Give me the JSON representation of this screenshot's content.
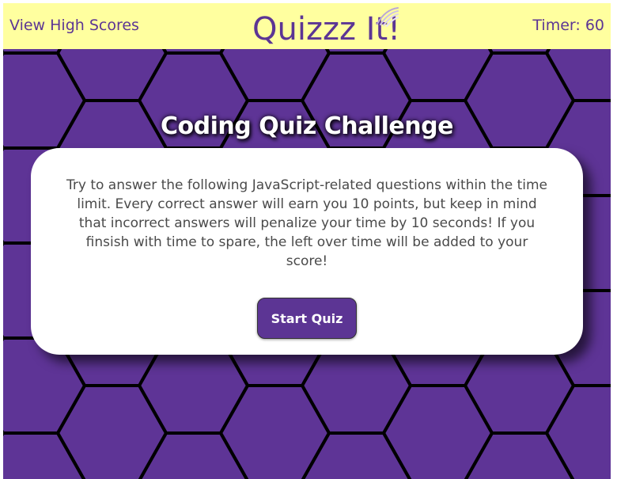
{
  "header": {
    "high_scores_link": "View High Scores",
    "logo_text": "Quizzz It!",
    "timer_label": "Timer: 60"
  },
  "main": {
    "title": "Coding Quiz Challenge",
    "intro_text": "Try to answer the following JavaScript-related questions within the time limit. Every correct answer will earn you 10 points, but keep in mind that incorrect answers will penalize your time by 10 seconds! If you finsish with time to spare, the left over time will be added to your score!",
    "start_button": "Start Quiz"
  },
  "icons": {
    "logo_swirl": "logo-swirl-icon"
  },
  "colors": {
    "header_bg": "#ffff9f",
    "brand_purple": "#5c3594",
    "board_bg": "#5e3496",
    "hex_outline": "#000000",
    "card_bg": "#ffffff"
  }
}
